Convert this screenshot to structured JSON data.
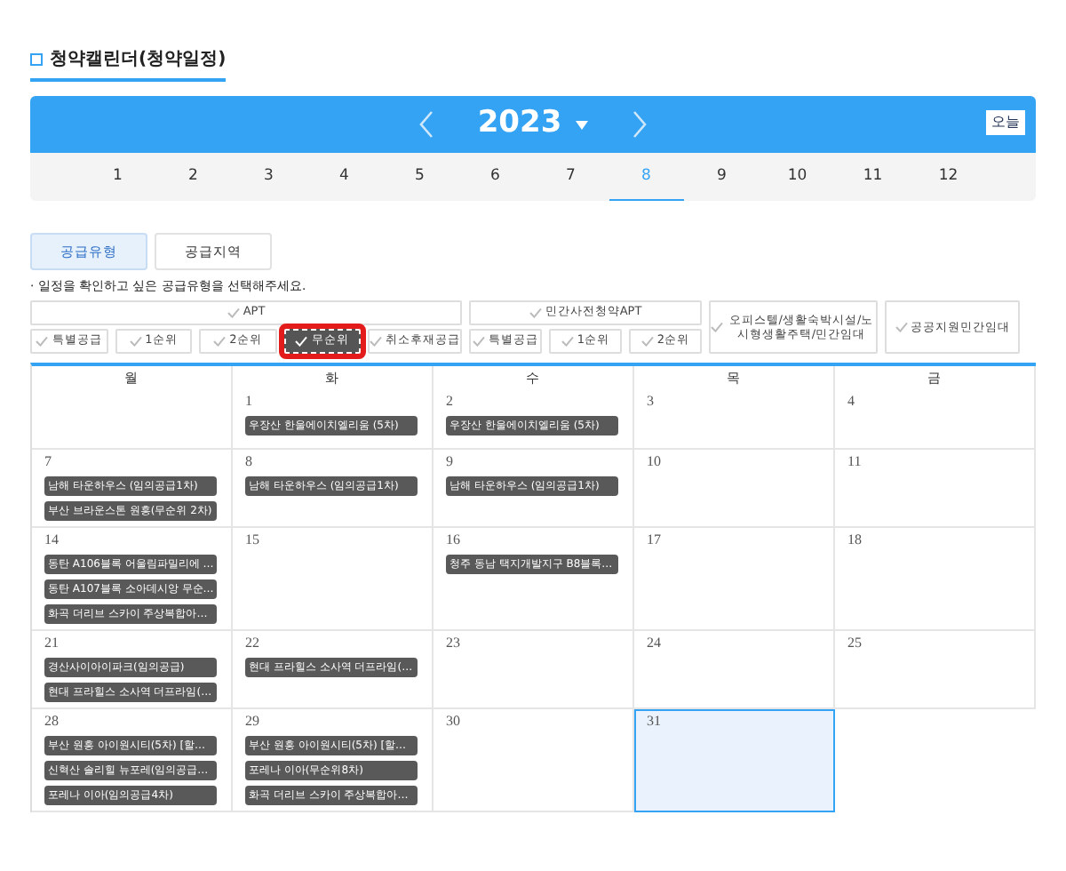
{
  "title": "청약캘린더(청약일정)",
  "year": "2023",
  "today_button": "오늘",
  "months": [
    {
      "label": "1",
      "selected": false
    },
    {
      "label": "2",
      "selected": false
    },
    {
      "label": "3",
      "selected": false
    },
    {
      "label": "4",
      "selected": false
    },
    {
      "label": "5",
      "selected": false
    },
    {
      "label": "6",
      "selected": false
    },
    {
      "label": "7",
      "selected": false
    },
    {
      "label": "8",
      "selected": true
    },
    {
      "label": "9",
      "selected": false
    },
    {
      "label": "10",
      "selected": false
    },
    {
      "label": "11",
      "selected": false
    },
    {
      "label": "12",
      "selected": false
    }
  ],
  "tabs": [
    {
      "label": "공급유형",
      "selected": true
    },
    {
      "label": "공급지역",
      "selected": false
    }
  ],
  "instruction": "· 일정을 확인하고 싶은 공급유형을 선택해주세요.",
  "filter_groups": [
    {
      "label": "APT",
      "checked": false,
      "options": [
        {
          "label": "특별공급",
          "checked": false
        },
        {
          "label": "1순위",
          "checked": false
        },
        {
          "label": "2순위",
          "checked": false
        },
        {
          "label": "무순위",
          "checked": true
        },
        {
          "label": "취소후재공급",
          "checked": false
        }
      ]
    },
    {
      "label": "민간사전청약APT",
      "checked": false,
      "options": [
        {
          "label": "특별공급",
          "checked": false
        },
        {
          "label": "1순위",
          "checked": false
        },
        {
          "label": "2순위",
          "checked": false
        }
      ]
    },
    {
      "label": "오피스텔/생활숙박시설/노시형생활주택/민간임대",
      "checked": false
    },
    {
      "label": "공공지원민간임대",
      "checked": false
    }
  ],
  "weekdays": [
    "월",
    "화",
    "수",
    "목",
    "금"
  ],
  "weeks": [
    [
      {
        "day": "1",
        "selected": false,
        "events": [
          "우장산 한울에이치엘리움 (5차)"
        ]
      },
      {
        "day": "2",
        "selected": false,
        "events": [
          "우장산 한울에이치엘리움 (5차)"
        ]
      },
      {
        "day": "3",
        "selected": false
      },
      {
        "day": "4",
        "selected": false
      }
    ],
    [
      {
        "day": "7",
        "selected": false,
        "events": [
          "남해 타운하우스 (임의공급1차)",
          "부산 브라운스톤 원흥(무순위 2차)"
        ]
      },
      {
        "day": "8",
        "selected": false,
        "events": [
          "남해 타운하우스 (임의공급1차)"
        ]
      },
      {
        "day": "9",
        "selected": false,
        "events": [
          "남해 타운하우스 (임의공급1차)"
        ]
      },
      {
        "day": "10",
        "selected": false
      },
      {
        "day": "11",
        "selected": false
      }
    ],
    [
      {
        "day": "14",
        "selected": false,
        "events": [
          "동탄 A106블록 어울림파밀리에 …",
          "동탄 A107블록 소아데시앙 무순…",
          "화곡 더리브 스카이 주상복합아…"
        ]
      },
      {
        "day": "15",
        "selected": false
      },
      {
        "day": "16",
        "selected": false,
        "events": [
          "청주 동남 택지개발지구 B8블록…"
        ]
      },
      {
        "day": "17",
        "selected": false
      },
      {
        "day": "18",
        "selected": false
      }
    ],
    [
      {
        "day": "21",
        "selected": false,
        "events": [
          "경산사이아이파크(임의공급)",
          "현대 프라힐스 소사역 더프라임(…"
        ]
      },
      {
        "day": "22",
        "selected": false,
        "events": [
          "현대 프라힐스 소사역 더프라임(…"
        ]
      },
      {
        "day": "23",
        "selected": false
      },
      {
        "day": "24",
        "selected": false
      },
      {
        "day": "25",
        "selected": false
      }
    ],
    [
      {
        "day": "28",
        "selected": false,
        "events": [
          "부산 원흥 아이원시티(5차) [할…",
          "신혁산 솔리힐 뉴포레(임의공급…",
          "포레나 이아(임의공급4차)"
        ]
      },
      {
        "day": "29",
        "selected": false,
        "events": [
          "부산 원흥 아이원시티(5차) [할…",
          "포레나 이아(무순위8차)",
          "화곡 더리브 스카이 주상복합아…"
        ]
      },
      {
        "day": "30",
        "selected": false
      },
      {
        "day": "31",
        "selected": true
      }
    ]
  ]
}
